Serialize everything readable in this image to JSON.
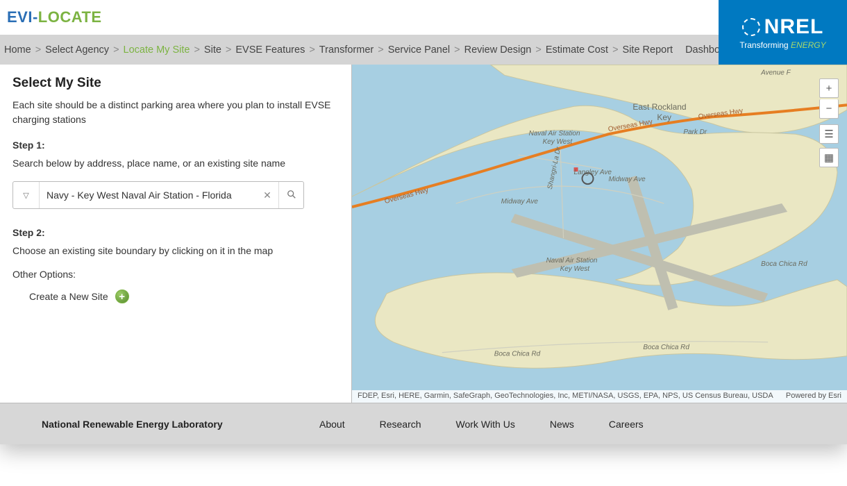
{
  "header": {
    "logo_prefix": "EVI-",
    "logo_suffix": "LOCATE"
  },
  "nrel": {
    "name": "NREL",
    "sub_pre": "Transforming ",
    "sub_em": "ENERGY"
  },
  "breadcrumb": {
    "items": [
      {
        "label": "Home",
        "active": false
      },
      {
        "label": "Select Agency",
        "active": false
      },
      {
        "label": "Locate My Site",
        "active": true
      },
      {
        "label": "Site",
        "active": false
      },
      {
        "label": "EVSE Features",
        "active": false
      },
      {
        "label": "Transformer",
        "active": false
      },
      {
        "label": "Service Panel",
        "active": false
      },
      {
        "label": "Review Design",
        "active": false
      },
      {
        "label": "Estimate Cost",
        "active": false
      },
      {
        "label": "Site Report",
        "active": false
      }
    ],
    "dashboard": "Dashboard"
  },
  "left": {
    "heading": "Select My Site",
    "desc": "Each site should be a distinct parking area where you plan to install EVSE charging stations",
    "step1_label": "Step 1:",
    "step1_text": "Search below by address, place name, or an existing site name",
    "search": {
      "value": "Navy - Key West Naval Air Station - Florida",
      "placeholder": ""
    },
    "step2_label": "Step 2:",
    "step2_text": "Choose an existing site boundary by clicking on it in the map",
    "other_label": "Other Options:",
    "create_label": "Create a New Site"
  },
  "map": {
    "labels": {
      "nas1": "Naval Air Station",
      "nas2": "Key West",
      "nas3": "Naval Air Station",
      "nas4": "Key West",
      "erk": "East Rockland",
      "erk2": "Key",
      "avenueF": "Avenue F",
      "parkDr": "Park Dr",
      "midway": "Midway Ave",
      "shangrila": "Shangri-La Dr",
      "langley": "Langley Ave",
      "overseas1": "Overseas Hwy",
      "overseas2": "Overseas Hwy",
      "overseas3": "Overseas Hwy",
      "bocachica1": "Boca Chica Rd",
      "bocachica2": "Boca Chica Rd",
      "bocachica3": "Boca Chica Rd"
    },
    "attribution_left": "FDEP, Esri, HERE, Garmin, SafeGraph, GeoTechnologies, Inc, METI/NASA, USGS, EPA, NPS, US Census Bureau, USDA",
    "attribution_right": "Powered by Esri"
  },
  "footer": {
    "org": "National Renewable Energy Laboratory",
    "links": [
      "About",
      "Research",
      "Work With Us",
      "News",
      "Careers"
    ]
  }
}
